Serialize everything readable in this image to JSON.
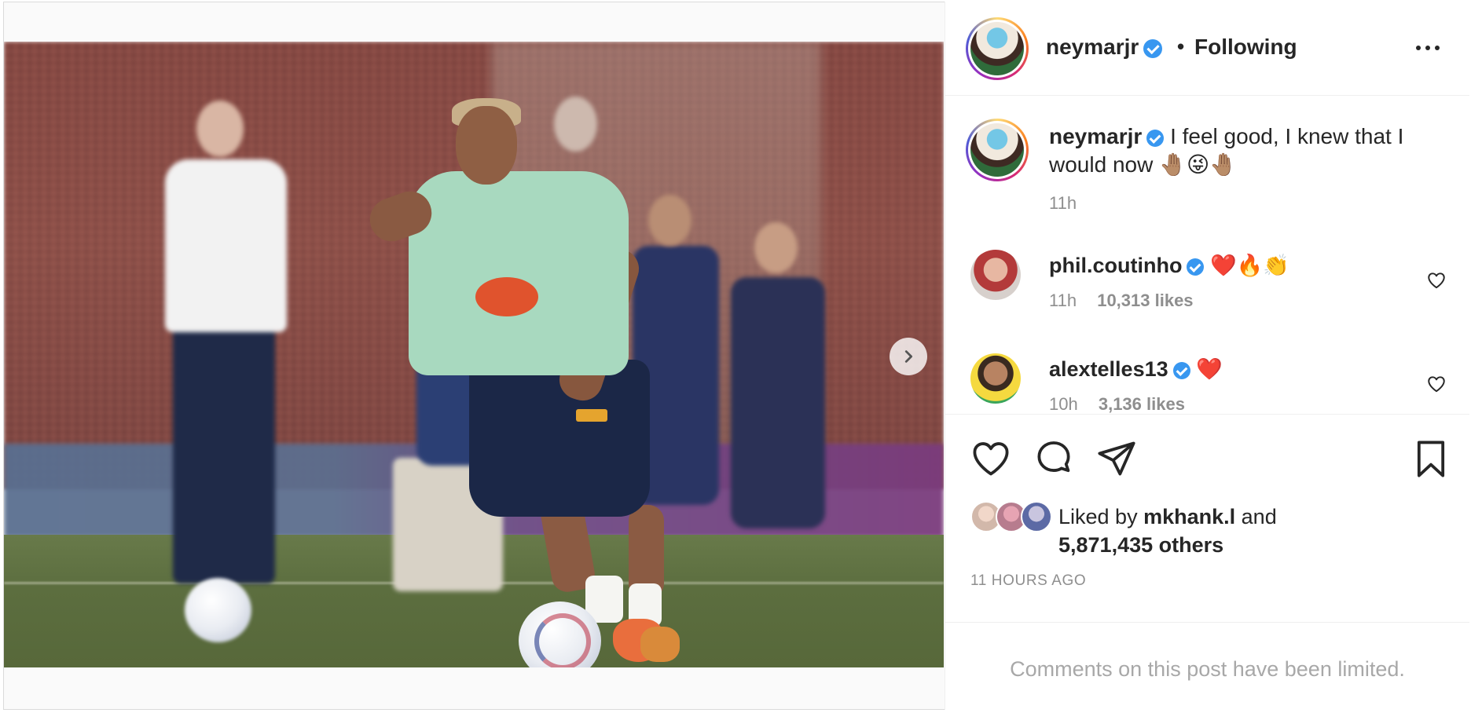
{
  "post": {
    "username": "neymarjr",
    "separator": "•",
    "follow_status": "Following",
    "media": {
      "slide_count": 2,
      "active_slide": 1
    }
  },
  "caption": {
    "username": "neymarjr",
    "text": "I feel good, I knew that I would now 🤚🏽😜🤚🏽",
    "time": "11h"
  },
  "comments": [
    {
      "username": "phil.coutinho",
      "text": "❤️🔥👏",
      "time": "11h",
      "likes": "10,313 likes"
    },
    {
      "username": "alextelles13",
      "text": "❤️",
      "time": "10h",
      "likes": "3,136 likes"
    }
  ],
  "likes": {
    "prefix": "Liked by",
    "user": "mkhank.l",
    "and": "and",
    "others": "5,871,435 others"
  },
  "timestamp": "11 HOURS AGO",
  "comments_limited": "Comments on this post have been limited.",
  "colors": {
    "verified": "#3897f0",
    "secondary_text": "#8e8e8e",
    "primary_text": "#262626"
  },
  "icons": [
    "verified-icon",
    "more-icon",
    "chevron-right-icon",
    "heart-icon",
    "comment-icon",
    "share-icon",
    "bookmark-icon"
  ]
}
